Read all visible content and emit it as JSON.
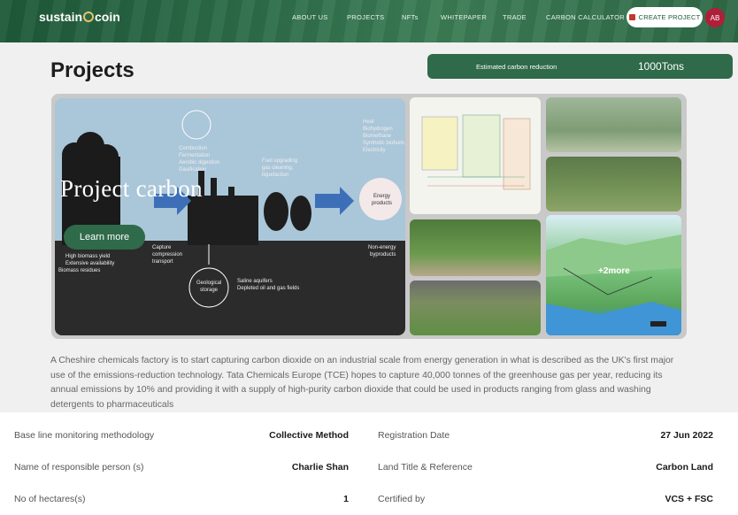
{
  "header": {
    "logo_left": "sustain",
    "logo_right": "coin",
    "nav": [
      "ABOUT US",
      "PROJECTS",
      "NFTs",
      "WHITEPAPER",
      "TRADE",
      "CARBON CALCULATOR"
    ],
    "create_label": "CREATE PROJECT",
    "avatar_initials": "AB"
  },
  "page": {
    "title": "Projects",
    "estimate_label": "Estimated carbon reduction",
    "estimate_value": "1000Tons"
  },
  "gallery": {
    "main_caption": "Project carbon",
    "learn_more": "Learn more",
    "more_badge": "+2more"
  },
  "description": "A Cheshire chemicals factory is to start capturing carbon dioxide on an industrial scale from energy generation in what is described as the UK's first major use of the emissions-reduction technology. Tata Chemicals Europe (TCE) hopes to capture 40,000 tonnes of the greenhouse gas per year, reducing its annual emissions by 10% and providing it with a supply of high-purity carbon dioxide that could be used in products ranging from glass and washing detergents to pharmaceuticals",
  "details": {
    "left": [
      {
        "label": "Base line monitoring methodology",
        "value": "Collective Method"
      },
      {
        "label": "Name of responsible person (s)",
        "value": "Charlie Shan"
      },
      {
        "label": "No of hectares(s)",
        "value": "1"
      }
    ],
    "right": [
      {
        "label": "Registration Date",
        "value": "27 Jun 2022"
      },
      {
        "label": "Land Title & Reference",
        "value": "Carbon Land"
      },
      {
        "label": "Certified by",
        "value": "VCS + FSC"
      }
    ]
  }
}
